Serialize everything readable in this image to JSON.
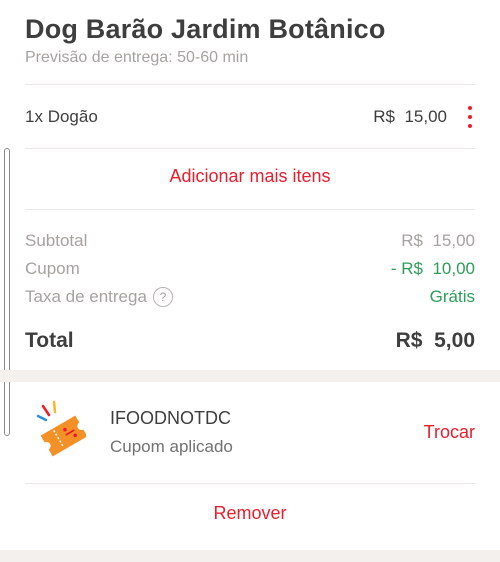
{
  "store": {
    "name": "Dog Barão Jardim Botânico",
    "delivery_estimate": "Previsão de entrega: 50-60 min"
  },
  "cart": {
    "items": [
      {
        "quantity": "1x",
        "name": "Dogão",
        "price": "R$  15,00"
      }
    ],
    "add_more_label": "Adicionar mais itens"
  },
  "summary": {
    "subtotal_label": "Subtotal",
    "subtotal_value": "R$  15,00",
    "coupon_label": "Cupom",
    "coupon_value": "- R$  10,00",
    "delivery_label": "Taxa de entrega",
    "delivery_help": "?",
    "delivery_value": "Grátis",
    "total_label": "Total",
    "total_value": "R$  5,00"
  },
  "coupon": {
    "code": "IFOODNOTDC",
    "status": "Cupom aplicado",
    "swap_label": "Trocar",
    "remove_label": "Remover",
    "icon": "coupon-ticket-icon"
  },
  "colors": {
    "accent": "#ea1d2c",
    "success": "#2d9d5a",
    "muted": "#a6a29f",
    "text": "#3e3e3e",
    "separator": "#f4f0ee"
  }
}
